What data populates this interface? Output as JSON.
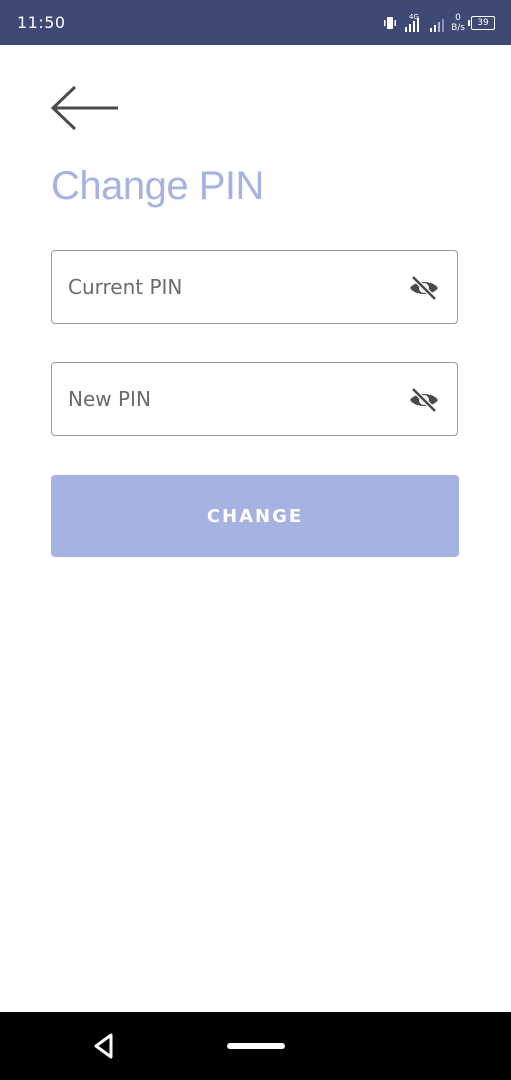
{
  "status_bar": {
    "time": "11:50",
    "network_type": "4G",
    "net_speed_value": "0",
    "net_speed_unit": "B/s",
    "battery_level": "39",
    "icons": [
      "vibrate-icon",
      "signal-4g-icon",
      "signal-icon",
      "net-speed",
      "battery-icon"
    ]
  },
  "header": {
    "back_icon": "arrow-left-icon",
    "title": "Change PIN"
  },
  "form": {
    "current_pin": {
      "placeholder": "Current PIN",
      "value": "",
      "visibility_icon": "eye-off-icon"
    },
    "new_pin": {
      "placeholder": "New PIN",
      "value": "",
      "visibility_icon": "eye-off-icon"
    },
    "submit_label": "CHANGE"
  },
  "nav_bar": {
    "back_icon": "triangle-back-icon",
    "home_icon": "home-pill-icon"
  },
  "colors": {
    "status_bar": "#3f4975",
    "accent": "#a6b2e1",
    "field_border": "#9a9a9a",
    "icon_dark": "#4a4a4a",
    "nav_bar": "#000000"
  }
}
